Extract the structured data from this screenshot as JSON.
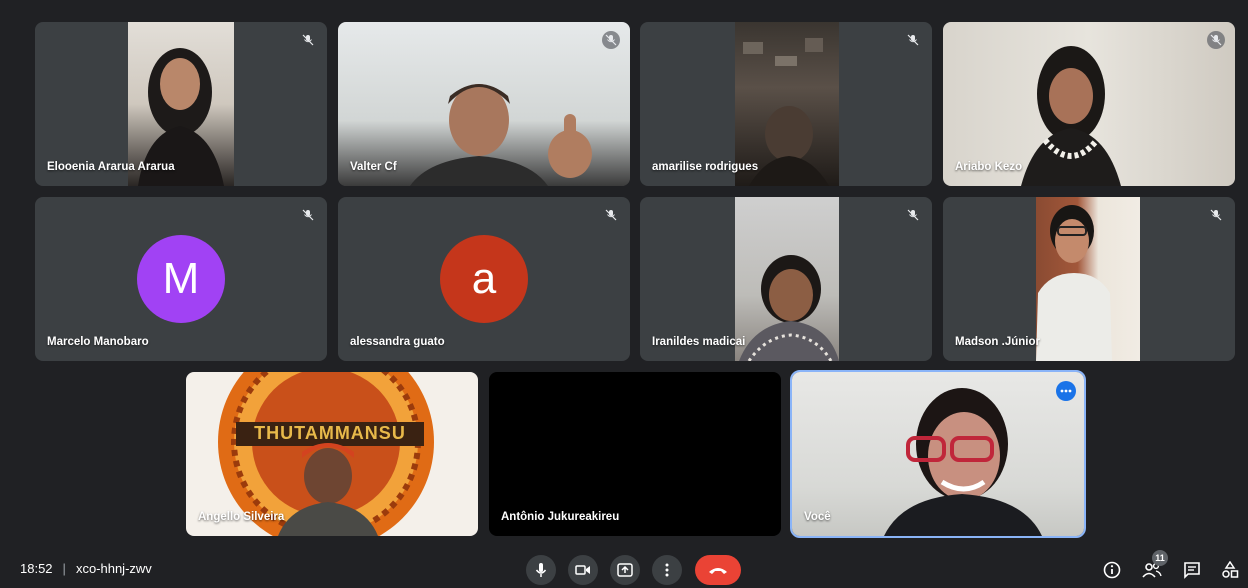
{
  "participants": [
    {
      "name": "Elooenia Ararua Ararua"
    },
    {
      "name": "Valter Cf"
    },
    {
      "name": "amarilise rodrigues"
    },
    {
      "name": "Ariabo Kezo"
    },
    {
      "name": "Marcelo Manobaro",
      "initial": "M",
      "color": "#a142f4"
    },
    {
      "name": "alessandra guato",
      "initial": "a",
      "color": "#d93025"
    },
    {
      "name": "Iranildes madicai"
    },
    {
      "name": "Madson .Júnior"
    },
    {
      "name": "Angello Silveira",
      "banner_text": "THUTAMMANSU"
    },
    {
      "name": "Antônio Jukureakireu"
    },
    {
      "name": "Você"
    }
  ],
  "meeting": {
    "time": "18:52",
    "separator": "|",
    "code": "xco-hhnj-zwv"
  },
  "participant_count": "11",
  "colors": {
    "background": "#202124",
    "tile": "#3c4043",
    "accent": "#1a73e8",
    "end_call": "#ea4335"
  }
}
